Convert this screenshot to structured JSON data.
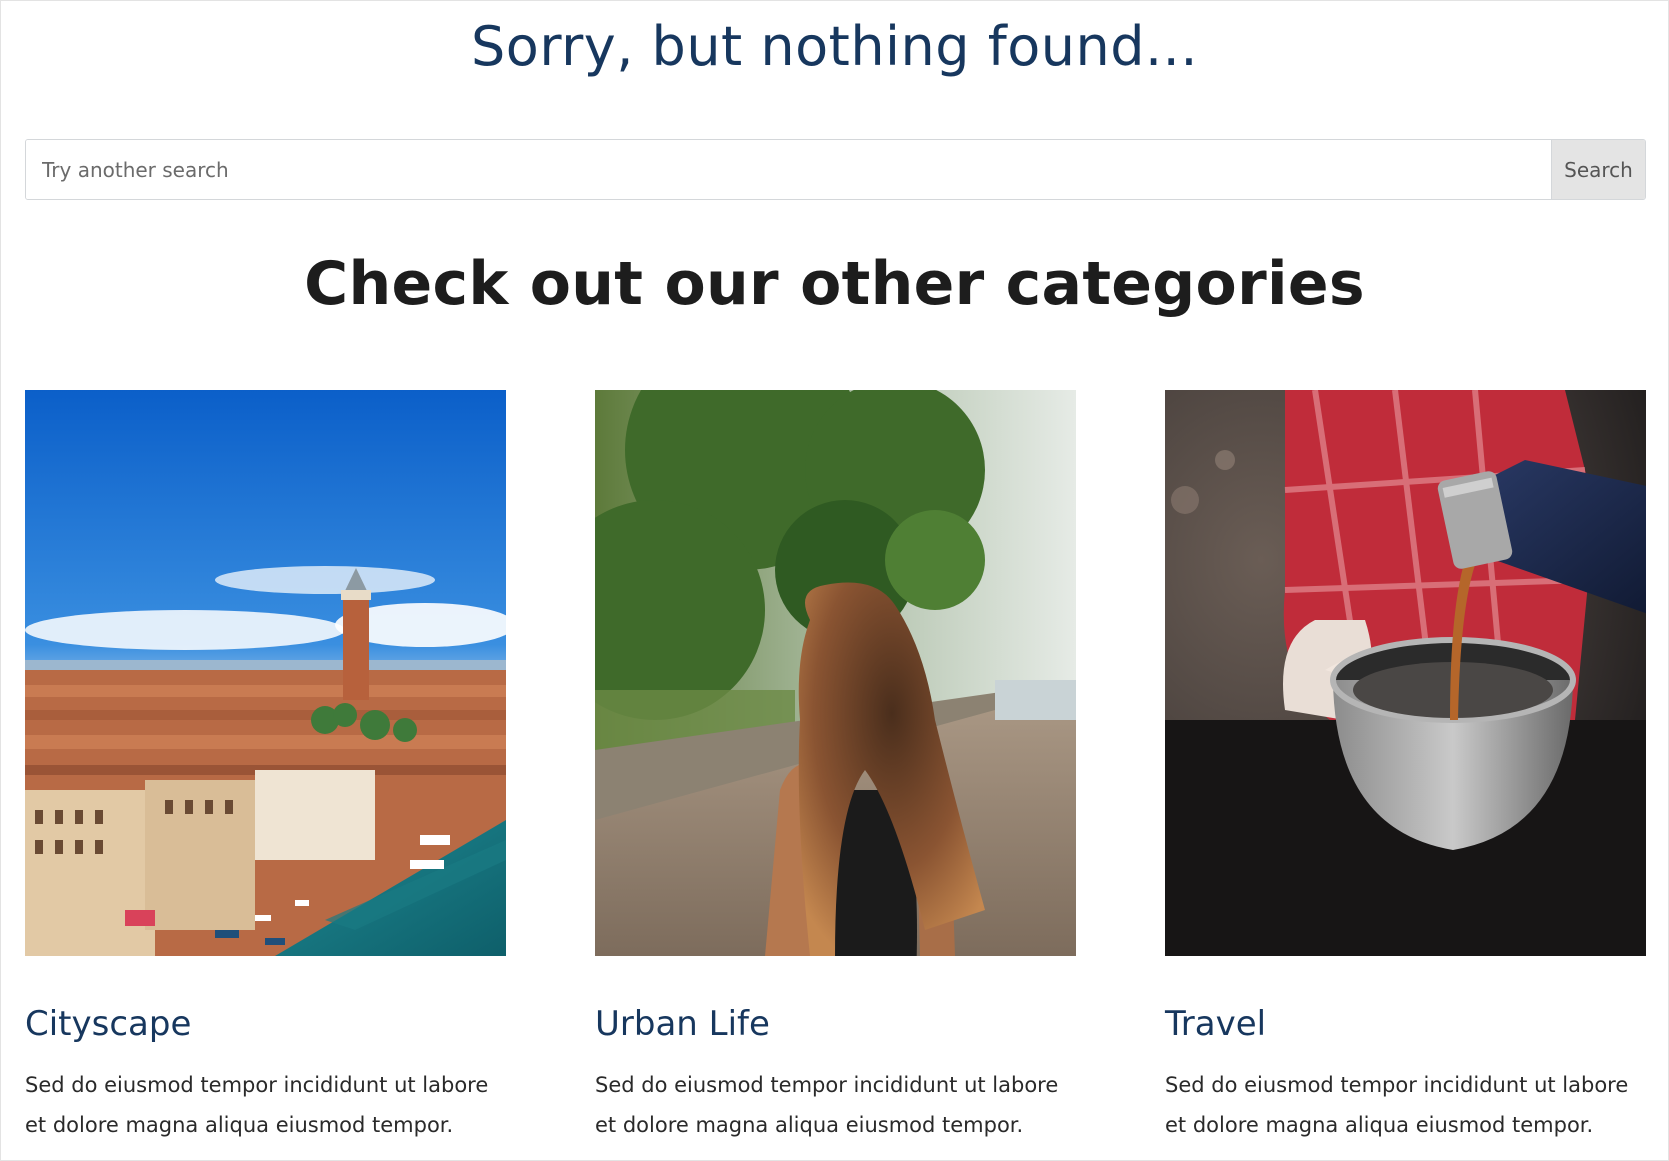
{
  "not_found_title": "Sorry, but nothing found...",
  "search": {
    "placeholder": "Try another search",
    "button_label": "Search"
  },
  "categories_heading": "Check out our other categories",
  "cards": [
    {
      "title": "Cityscape",
      "text": "Sed do eiusmod tempor incididunt ut labore et dolore magna aliqua eiusmod tempor.",
      "image": "venice-cityscape-photo"
    },
    {
      "title": "Urban Life",
      "text": "Sed do eiusmod tempor incididunt ut labore et dolore magna aliqua eiusmod tempor.",
      "image": "woman-walking-path-photo"
    },
    {
      "title": "Travel",
      "text": "Sed do eiusmod tempor incididunt ut labore et dolore magna aliqua eiusmod tempor.",
      "image": "pouring-coffee-cup-photo"
    }
  ],
  "colors": {
    "title_blue": "#17375e",
    "heading_dark": "#1d1d1d",
    "button_bg": "#e4e4e4"
  }
}
